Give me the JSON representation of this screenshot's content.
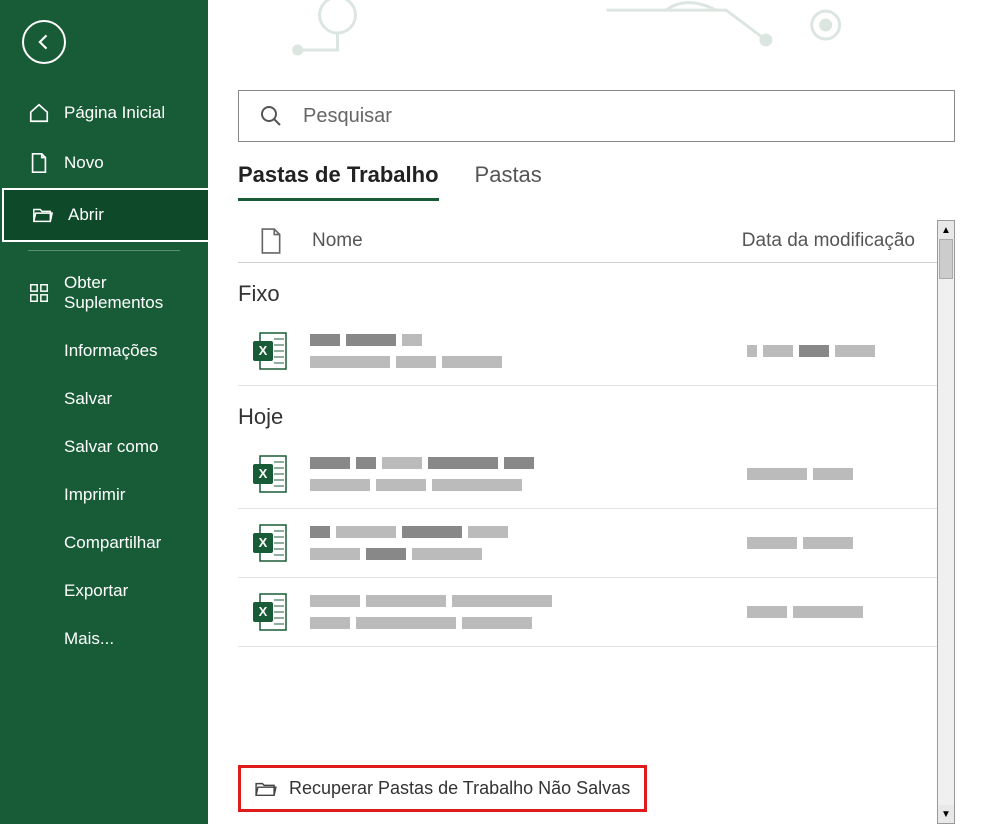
{
  "sidebar": {
    "back_label": "Voltar",
    "items": [
      {
        "label": "Página Inicial",
        "icon": "home"
      },
      {
        "label": "Novo",
        "icon": "doc"
      },
      {
        "label": "Abrir",
        "icon": "folder",
        "active": true
      },
      {
        "label": "Obter Suplementos",
        "icon": "grid"
      },
      {
        "label": "Informações"
      },
      {
        "label": "Salvar"
      },
      {
        "label": "Salvar como"
      },
      {
        "label": "Imprimir"
      },
      {
        "label": "Compartilhar"
      },
      {
        "label": "Exportar"
      },
      {
        "label": "Mais..."
      }
    ]
  },
  "search": {
    "placeholder": "Pesquisar"
  },
  "tabs": {
    "workbooks": "Pastas de Trabalho",
    "folders": "Pastas",
    "active": "workbooks"
  },
  "columns": {
    "name": "Nome",
    "modified": "Data da modificação"
  },
  "sections": {
    "pinned": "Fixo",
    "today": "Hoje"
  },
  "recover_button": "Recuperar Pastas de Trabalho Não Salvas",
  "colors": {
    "brand": "#185c37",
    "highlight": "#e01b1b"
  }
}
